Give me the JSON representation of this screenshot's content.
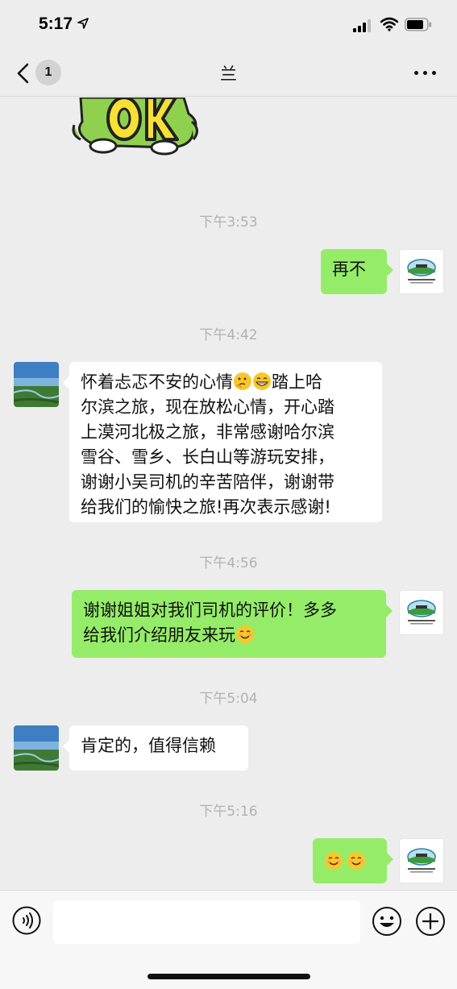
{
  "status_bar": {
    "time": "5:17",
    "location_icon": "location-arrow-icon"
  },
  "nav": {
    "unread_count": "1",
    "title": "兰",
    "back_icon": "chevron-left-icon",
    "more_icon": "more-dots-icon"
  },
  "messages": [
    {
      "type": "sticker",
      "side": "left",
      "sticker_text": "OK"
    },
    {
      "type": "timestamp",
      "text": "下午3:53"
    },
    {
      "type": "text",
      "side": "right",
      "text": "再不"
    },
    {
      "type": "timestamp",
      "text": "下午4:42"
    },
    {
      "type": "text",
      "side": "left",
      "lines": [
        "怀着忐忑不安的心情",
        "踏上哈",
        "尔滨之旅，现在放松心情，开心踏",
        "上漠河北极之旅，非常感谢哈尔滨",
        "雪谷、雪乡、长白山等游玩安排，",
        "谢谢小吴司机的辛苦陪伴，谢谢带",
        "给我们的愉快之旅!再次表示感谢!"
      ]
    },
    {
      "type": "timestamp",
      "text": "下午4:56"
    },
    {
      "type": "text",
      "side": "right",
      "lines": [
        "谢谢姐姐对我们司机的评价！多多",
        "给我们介绍朋友来玩"
      ]
    },
    {
      "type": "timestamp",
      "text": "下午5:04"
    },
    {
      "type": "text",
      "side": "left",
      "text": "肯定的，值得信赖"
    },
    {
      "type": "timestamp",
      "text": "下午5:16"
    },
    {
      "type": "emoji_only",
      "side": "right",
      "emojis": [
        "smile-icon",
        "smile-icon"
      ]
    }
  ],
  "input_bar": {
    "voice_icon": "voice-icon",
    "emoji_icon": "emoji-face-icon",
    "plus_icon": "plus-circle-icon",
    "placeholder": ""
  },
  "colors": {
    "background": "#ededed",
    "sent_bubble": "#95ec69",
    "received_bubble": "#ffffff",
    "timestamp": "#b1b1b1"
  }
}
